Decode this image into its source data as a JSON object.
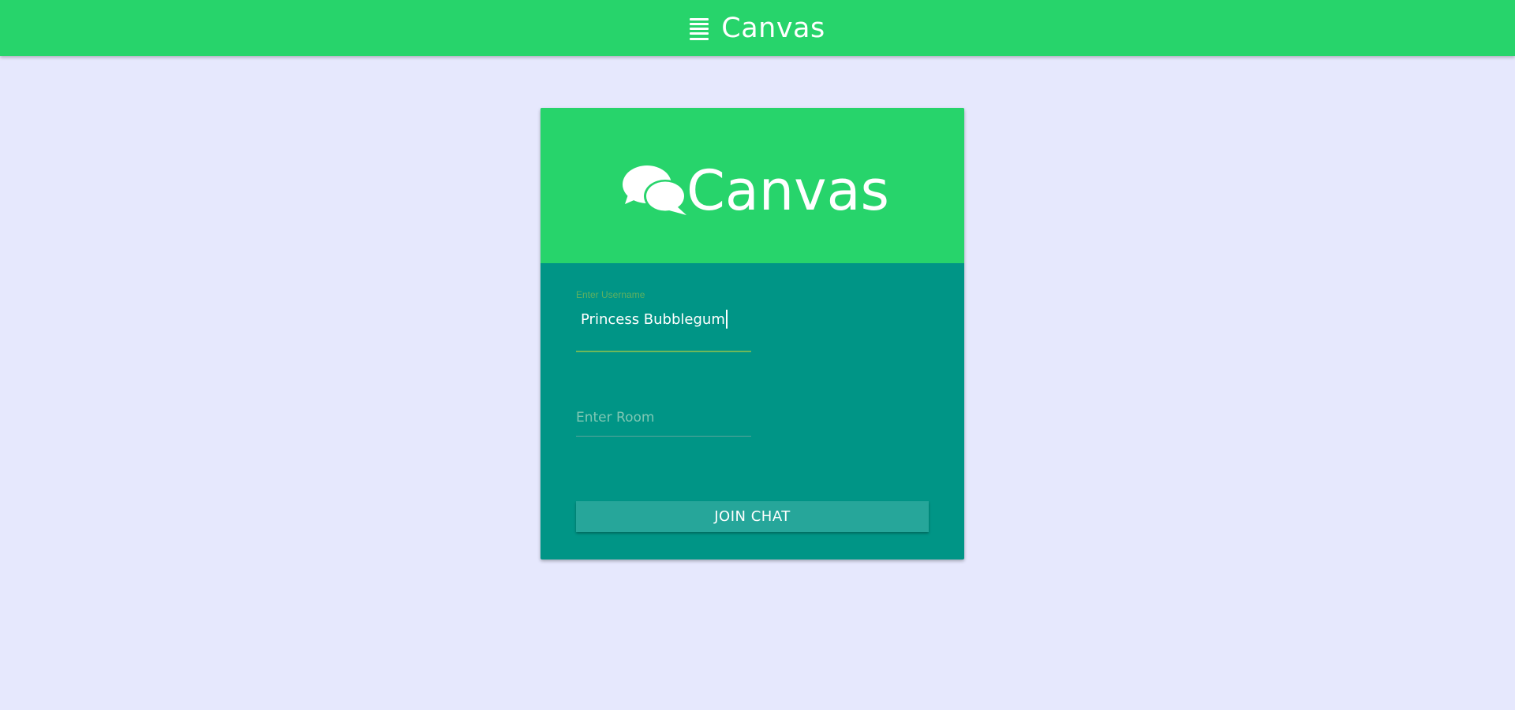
{
  "header": {
    "title": "Canvas",
    "menu_icon": "menu-icon"
  },
  "login_card": {
    "logo": {
      "icon": "chat-bubbles-icon",
      "text": "Canvas"
    },
    "username_field": {
      "label": "Enter Username",
      "value": "Princess Bubblegum"
    },
    "room_field": {
      "placeholder": "Enter Room",
      "value": ""
    },
    "join_button_label": "JOIN CHAT"
  },
  "colors": {
    "primary_green": "#27d46b",
    "card_teal": "#009586",
    "button_teal": "#26a69a",
    "background": "#e6e8fd",
    "label_green": "#5fb060"
  }
}
